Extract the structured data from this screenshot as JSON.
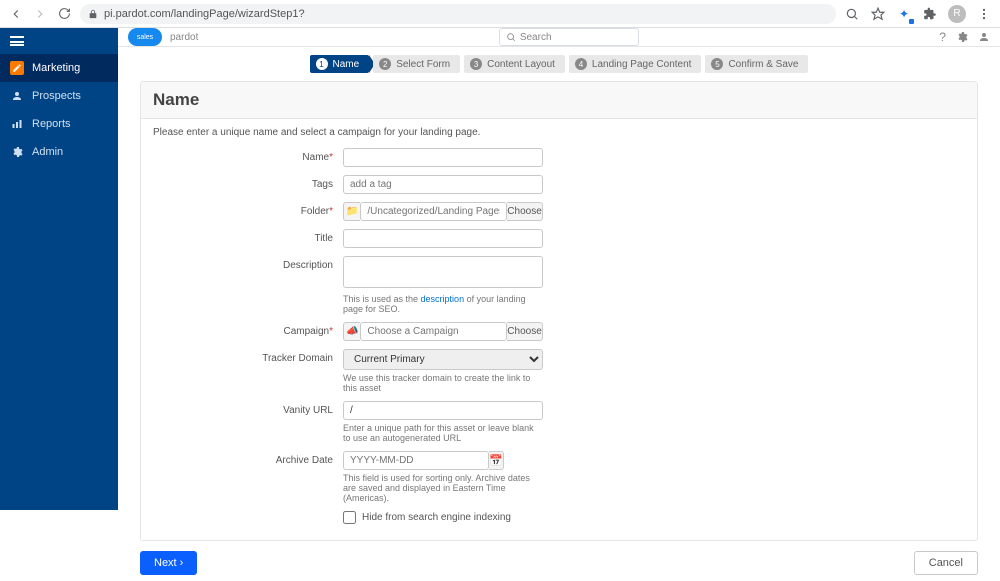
{
  "browser": {
    "url": "pi.pardot.com/landingPage/wizardStep1?",
    "avatar_letter": "R"
  },
  "sidebar": {
    "items": [
      {
        "label": "Marketing",
        "icon": "pencil"
      },
      {
        "label": "Prospects",
        "icon": "user"
      },
      {
        "label": "Reports",
        "icon": "chart"
      },
      {
        "label": "Admin",
        "icon": "gear"
      }
    ]
  },
  "topbar": {
    "logo_sub": "pardot",
    "search_placeholder": "Search"
  },
  "wizard": {
    "steps": [
      {
        "num": "1",
        "label": "Name"
      },
      {
        "num": "2",
        "label": "Select Form"
      },
      {
        "num": "3",
        "label": "Content Layout"
      },
      {
        "num": "4",
        "label": "Landing Page Content"
      },
      {
        "num": "5",
        "label": "Confirm & Save"
      }
    ]
  },
  "panel": {
    "title": "Name",
    "intro": "Please enter a unique name and select a campaign for your landing page."
  },
  "form": {
    "name_label": "Name",
    "tags_label": "Tags",
    "tags_placeholder": "add a tag",
    "folder_label": "Folder",
    "folder_placeholder": "/Uncategorized/Landing Pages",
    "choose_btn": "Choose",
    "title_label": "Title",
    "description_label": "Description",
    "description_help_pre": "This is used as the ",
    "description_help_link": "description",
    "description_help_post": " of your landing page for SEO.",
    "campaign_label": "Campaign",
    "campaign_placeholder": "Choose a Campaign",
    "tracker_label": "Tracker Domain",
    "tracker_value": "Current Primary",
    "tracker_help": "We use this tracker domain to create the link to this asset",
    "vanity_label": "Vanity URL",
    "vanity_value": "/",
    "vanity_help": "Enter a unique path for this asset or leave blank to use an autogenerated URL",
    "archive_label": "Archive Date",
    "archive_placeholder": "YYYY-MM-DD",
    "archive_help": "This field is used for sorting only. Archive dates are saved and displayed in Eastern Time (Americas).",
    "hide_label": "Hide from search engine indexing"
  },
  "footer": {
    "next": "Next ›",
    "cancel": "Cancel"
  }
}
